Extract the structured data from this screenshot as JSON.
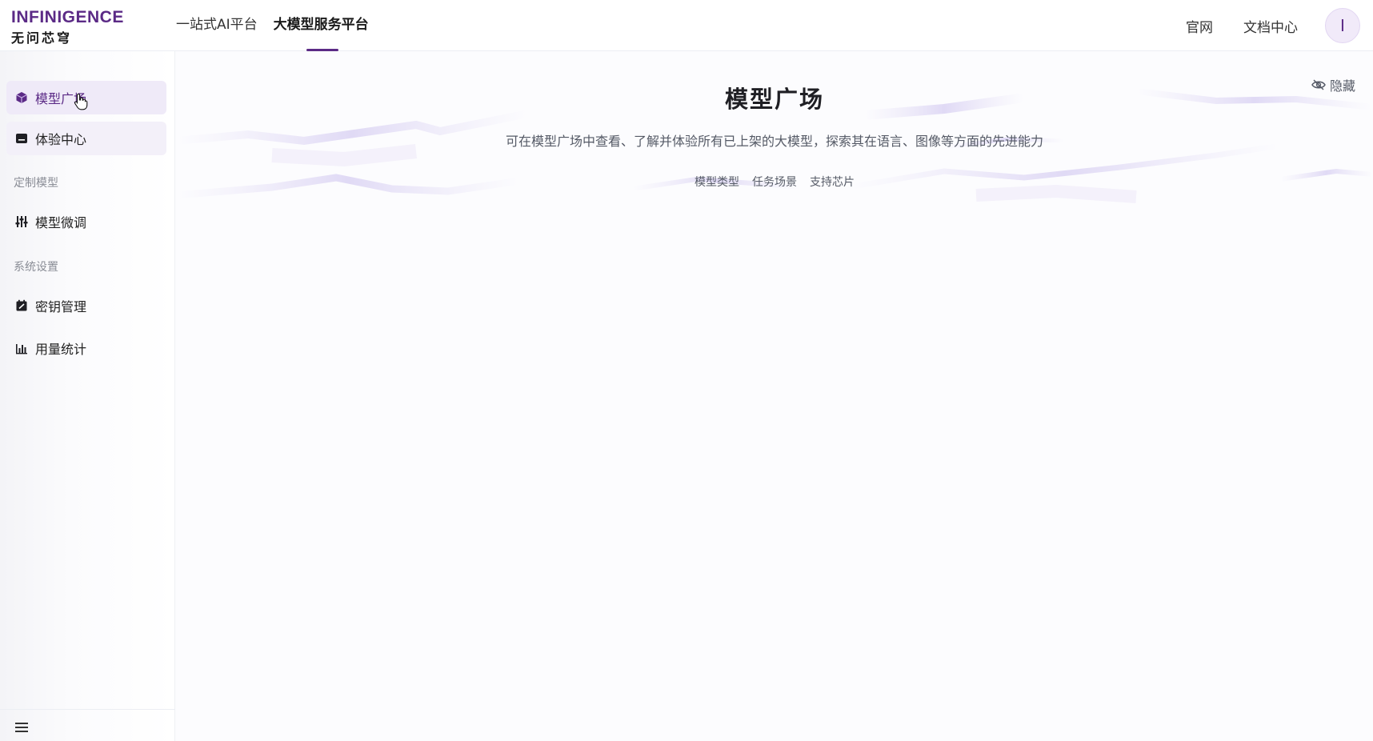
{
  "brand": {
    "name_en": "INFINIGENCE",
    "name_cn": "无问芯穹",
    "accent_color": "#5b2a86"
  },
  "topnav": {
    "items": [
      {
        "label": "一站式AI平台",
        "active": false
      },
      {
        "label": "大模型服务平台",
        "active": true
      }
    ],
    "right_links": [
      "官网",
      "文档中心"
    ],
    "avatar_letter": "I"
  },
  "sidebar": {
    "items": [
      {
        "label": "模型广场",
        "icon": "cube-icon",
        "active": true
      },
      {
        "label": "体验中心",
        "icon": "terminal-icon",
        "active": false
      }
    ],
    "group_custom": {
      "title": "定制模型",
      "items": [
        {
          "label": "模型微调",
          "icon": "sliders-icon"
        }
      ]
    },
    "group_system": {
      "title": "系统设置",
      "items": [
        {
          "label": "密钥管理",
          "icon": "key-doc-icon"
        },
        {
          "label": "用量统计",
          "icon": "bar-chart-icon"
        }
      ]
    },
    "footer_icon": "menu-icon"
  },
  "hero": {
    "title": "模型广场",
    "description": "可在模型广场中查看、了解并体验所有已上架的大模型，探索其在语言、图像等方面的先进能力",
    "tags": [
      "模型类型",
      "任务场景",
      "支持芯片"
    ],
    "hide_label": "隐藏",
    "hide_icon": "eye-off-icon"
  }
}
